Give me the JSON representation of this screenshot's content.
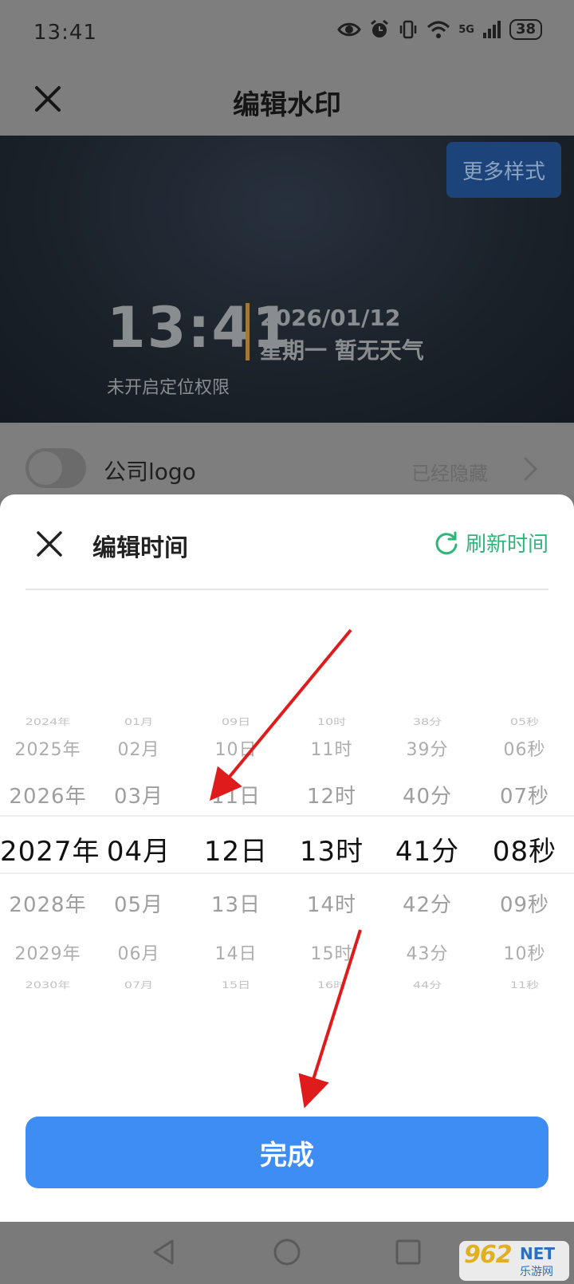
{
  "status_bar": {
    "time": "13:41",
    "network": "5G",
    "battery": "38"
  },
  "header": {
    "title": "编辑水印"
  },
  "preview": {
    "more_styles_label": "更多样式",
    "time": "13:41",
    "date": "2026/01/12",
    "day_weather": "星期一 暂无天气",
    "location": "未开启定位权限"
  },
  "logo_row": {
    "label": "公司logo",
    "status": "已经隐藏",
    "enabled": false
  },
  "sheet": {
    "title": "编辑时间",
    "refresh_label": "刷新时间",
    "done_label": "完成"
  },
  "picker": {
    "columns": [
      [
        "2024年",
        "2025年",
        "2026年",
        "2027年",
        "2028年",
        "2029年",
        "2030年"
      ],
      [
        "01月",
        "02月",
        "03月",
        "04月",
        "05月",
        "06月",
        "07月"
      ],
      [
        "09日",
        "10日",
        "11日",
        "12日",
        "13日",
        "14日",
        "15日"
      ],
      [
        "10时",
        "11时",
        "12时",
        "13时",
        "14时",
        "15时",
        "16时"
      ],
      [
        "38分",
        "39分",
        "40分",
        "41分",
        "42分",
        "43分",
        "44分"
      ],
      [
        "05秒",
        "06秒",
        "07秒",
        "08秒",
        "09秒",
        "10秒",
        "11秒"
      ]
    ],
    "selected": [
      "2027年",
      "04月",
      "12日",
      "13时",
      "41分",
      "08秒"
    ]
  },
  "corner_logo": {
    "number": "962",
    "suffix": "NET",
    "sub": "乐游网"
  },
  "colors": {
    "accent": "#3d8df5",
    "refresh": "#2fb57a",
    "arrow": "#e01b1b"
  }
}
